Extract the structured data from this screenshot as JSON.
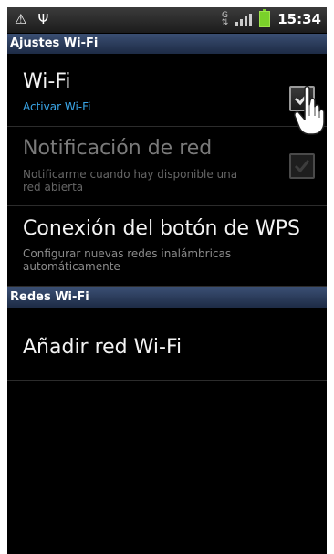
{
  "status": {
    "left_icons": [
      "warning-icon",
      "usb-icon"
    ],
    "network_badge": "G",
    "time": "15:34"
  },
  "sections": {
    "wifi_settings": "Ajustes Wi-Fi",
    "wifi_networks": "Redes Wi-Fi"
  },
  "wifi": {
    "title": "Wi-Fi",
    "subtitle": "Activar Wi-Fi",
    "checked": true
  },
  "notification": {
    "title": "Notificación de red",
    "subtitle_line1": "Notificarme cuando hay disponible una",
    "subtitle_line2": "red abierta",
    "checked": false
  },
  "wps": {
    "title": "Conexión del botón de WPS",
    "subtitle_line1": "Configurar nuevas redes inalámbricas",
    "subtitle_line2": "automáticamente"
  },
  "add_network": {
    "title": "Añadir red Wi-Fi"
  },
  "colors": {
    "accent_blue": "#3aa6e8",
    "section_bar": "#2b3d5e",
    "background": "#000000"
  }
}
